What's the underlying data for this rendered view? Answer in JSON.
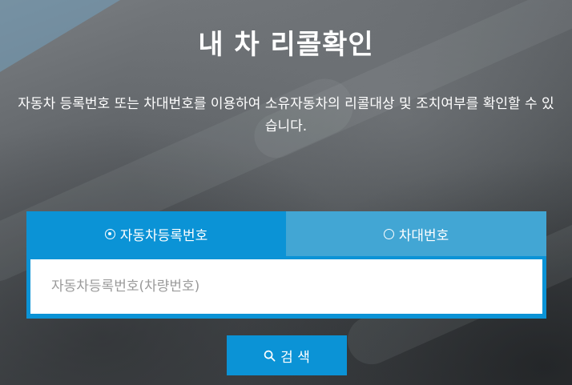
{
  "page": {
    "title": "내 차 리콜확인",
    "description": "자동차 등록번호 또는 차대번호를 이용하여 소유자동차의 리콜대상 및 조치여부를 확인할 수 있습니다."
  },
  "tabs": [
    {
      "label": "자동차등록번호",
      "selected": true
    },
    {
      "label": "차대번호",
      "selected": false
    }
  ],
  "search": {
    "placeholder": "자동차등록번호(차량번호)",
    "value": "",
    "button_label": "검 색"
  },
  "colors": {
    "accent": "#0b93d6",
    "tab_inactive": "#42a6d4",
    "text": "#ffffff"
  },
  "icons": {
    "radio_selected": "radio-checked-icon",
    "radio_unselected": "radio-unchecked-icon",
    "search": "search-icon"
  }
}
